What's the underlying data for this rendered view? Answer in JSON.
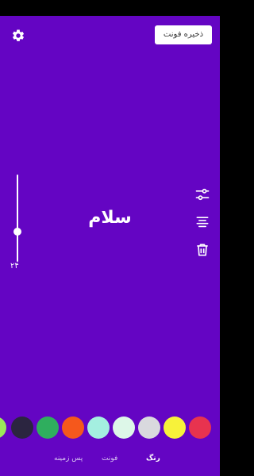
{
  "header": {
    "save_label": "ذخیره فونت"
  },
  "editor": {
    "text": "سلام",
    "size_value": "۲۴",
    "size_fraction": 0.24
  },
  "colors": {
    "background": "#6405C3",
    "text": "#FFFFFF"
  },
  "toolbar": {
    "icons": [
      "settings-sliders-icon",
      "align-center-icon",
      "trash-icon"
    ]
  },
  "palette": [
    {
      "color": "#9BE85A"
    },
    {
      "color": "#2B2540"
    },
    {
      "color": "#2FAE5E"
    },
    {
      "color": "#F5581C"
    },
    {
      "color": "#A4EFE0"
    },
    {
      "color": "#DDF7E8"
    },
    {
      "color": "#D9D9DE"
    },
    {
      "color": "#F7F23A"
    },
    {
      "color": "#E8334F"
    }
  ],
  "tabs": [
    {
      "label": "رنگ",
      "active": true
    },
    {
      "label": "فونت",
      "active": false
    },
    {
      "label": "پس زمینه",
      "active": false
    }
  ]
}
